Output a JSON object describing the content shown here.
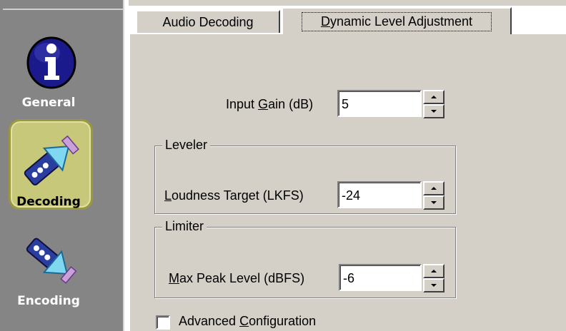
{
  "sidebar": {
    "items": [
      {
        "label": "General",
        "icon": "info-icon"
      },
      {
        "label": "Decoding",
        "icon": "decoding-icon",
        "selected": true
      },
      {
        "label": "Encoding",
        "icon": "encoding-icon"
      }
    ]
  },
  "tabs": [
    {
      "label": "Audio Decoding",
      "selected": false
    },
    {
      "label_pre": "",
      "label_accel": "D",
      "label_post": "ynamic Level Adjustment",
      "selected": true
    }
  ],
  "input_gain": {
    "label_pre": "Input ",
    "label_accel": "G",
    "label_post": "ain (dB)",
    "value": "5"
  },
  "leveler": {
    "group_title": "Leveler",
    "loudness": {
      "label_pre": "",
      "label_accel": "L",
      "label_post": "oudness Target (LKFS)",
      "value": "-24"
    }
  },
  "limiter": {
    "group_title": "Limiter",
    "max_peak": {
      "label_pre": "",
      "label_accel": "M",
      "label_post": "ax Peak Level (dBFS)",
      "value": "-6"
    }
  },
  "advanced": {
    "label_pre": "Advanced ",
    "label_accel": "C",
    "label_post": "onfiguration",
    "checked": false
  },
  "colors": {
    "sidebar_bg": "#858585",
    "panel_bg": "#d4d0c8",
    "selected_bg": "#c8c87a",
    "info_blue": "#1a1a8c"
  }
}
